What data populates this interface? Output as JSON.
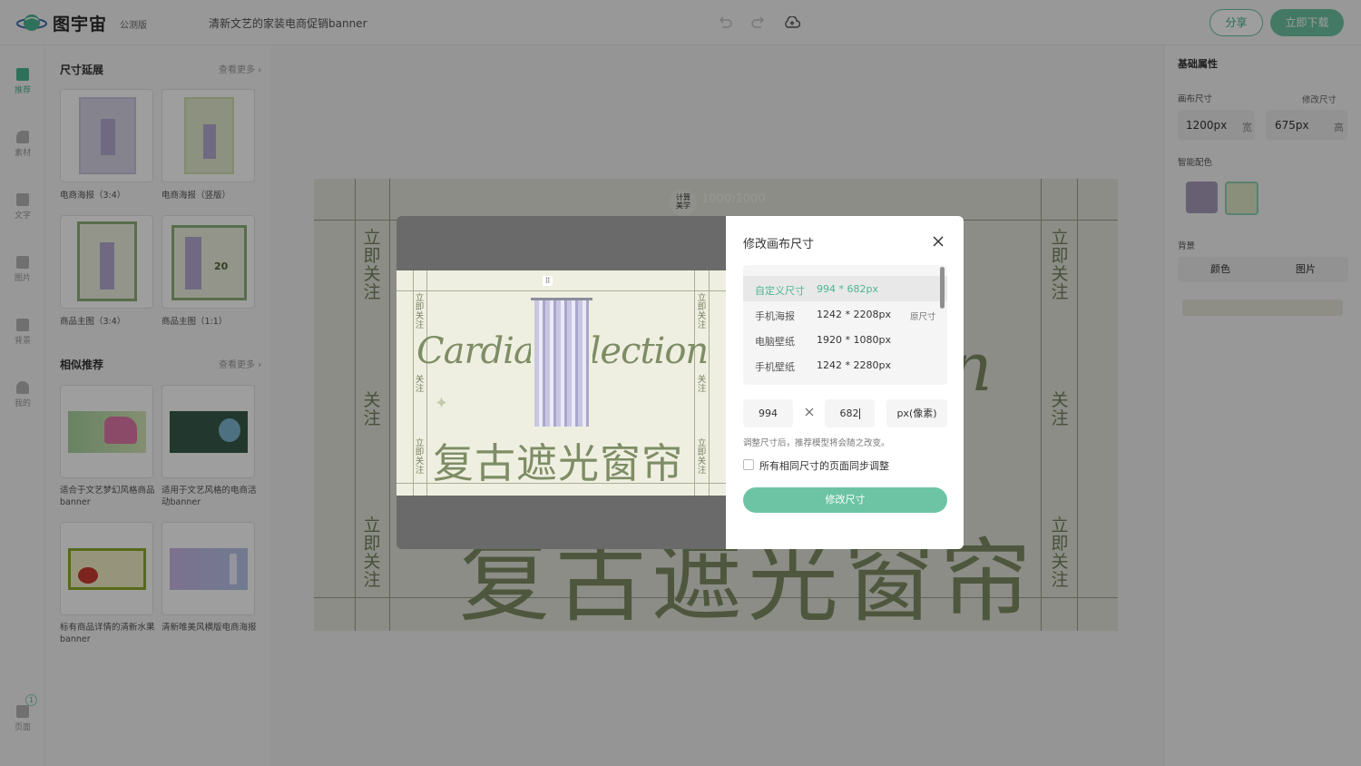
{
  "header": {
    "app_name": "图宇宙",
    "edition": "公测版",
    "doc_title": "清新文艺的家装电商促销banner",
    "share_label": "分享",
    "download_label": "立即下载"
  },
  "leftnav": {
    "items": [
      {
        "label": "推荐",
        "icon": "recommend-icon"
      },
      {
        "label": "素材",
        "icon": "shapes-icon"
      },
      {
        "label": "文字",
        "icon": "text-icon"
      },
      {
        "label": "图片",
        "icon": "image-icon"
      },
      {
        "label": "背景",
        "icon": "background-icon"
      },
      {
        "label": "我的",
        "icon": "user-icon"
      }
    ],
    "pages_label": "页面",
    "pages_count": "1"
  },
  "panel": {
    "section1_title": "尺寸延展",
    "section1_more": "查看更多",
    "section1_cards": [
      {
        "label": "电商海报（3:4）"
      },
      {
        "label": "电商海报（竖版）"
      },
      {
        "label": "商品主图（3:4）"
      },
      {
        "label": "商品主图（1:1）"
      }
    ],
    "section2_title": "相似推荐",
    "section2_more": "查看更多",
    "section2_cards": [
      {
        "label": "适合于文艺梦幻风格商品banner"
      },
      {
        "label": "适用于文艺风格的电商活动banner"
      },
      {
        "label": "标有商品详情的清新水果banner"
      },
      {
        "label": "清新唯美风横版电商海报"
      }
    ]
  },
  "canvas": {
    "badge": "计算\n美学",
    "size_watermark": "1000:1000",
    "vertical_text_full": "立即关注",
    "vertical_text_short": "关注",
    "script_text": "Cardia Selection",
    "title_text": "复古遮光窗帘"
  },
  "rightpanel": {
    "section_title": "基础属性",
    "canvas_size_label": "画布尺寸",
    "resize_link": "修改尺寸",
    "width_value": "1200px",
    "width_unit": "宽",
    "height_value": "675px",
    "height_unit": "高",
    "smart_color_label": "智能配色",
    "swatch1": "#a79bb8",
    "swatch2": "#dfe7c9",
    "background_label": "背景",
    "tab_color": "颜色",
    "tab_image": "图片"
  },
  "modal": {
    "title": "修改画布尺寸",
    "size_options": [
      {
        "name": "自定义尺寸",
        "value": "994 * 682px",
        "note": ""
      },
      {
        "name": "手机海报",
        "value": "1242 * 2208px",
        "note": "原尺寸"
      },
      {
        "name": "电脑壁纸",
        "value": "1920 * 1080px",
        "note": ""
      },
      {
        "name": "手机壁纸",
        "value": "1242 * 2280px",
        "note": ""
      }
    ],
    "width_input": "994",
    "height_input": "682",
    "unit_label": "px(像素)",
    "hint": "调整尺寸后，推荐模型将会随之改变。",
    "sync_label": "所有相同尺寸的页面同步调整",
    "confirm_label": "修改尺寸"
  },
  "colors": {
    "accent": "#6cc4a4",
    "title_green": "#7e8d65"
  }
}
